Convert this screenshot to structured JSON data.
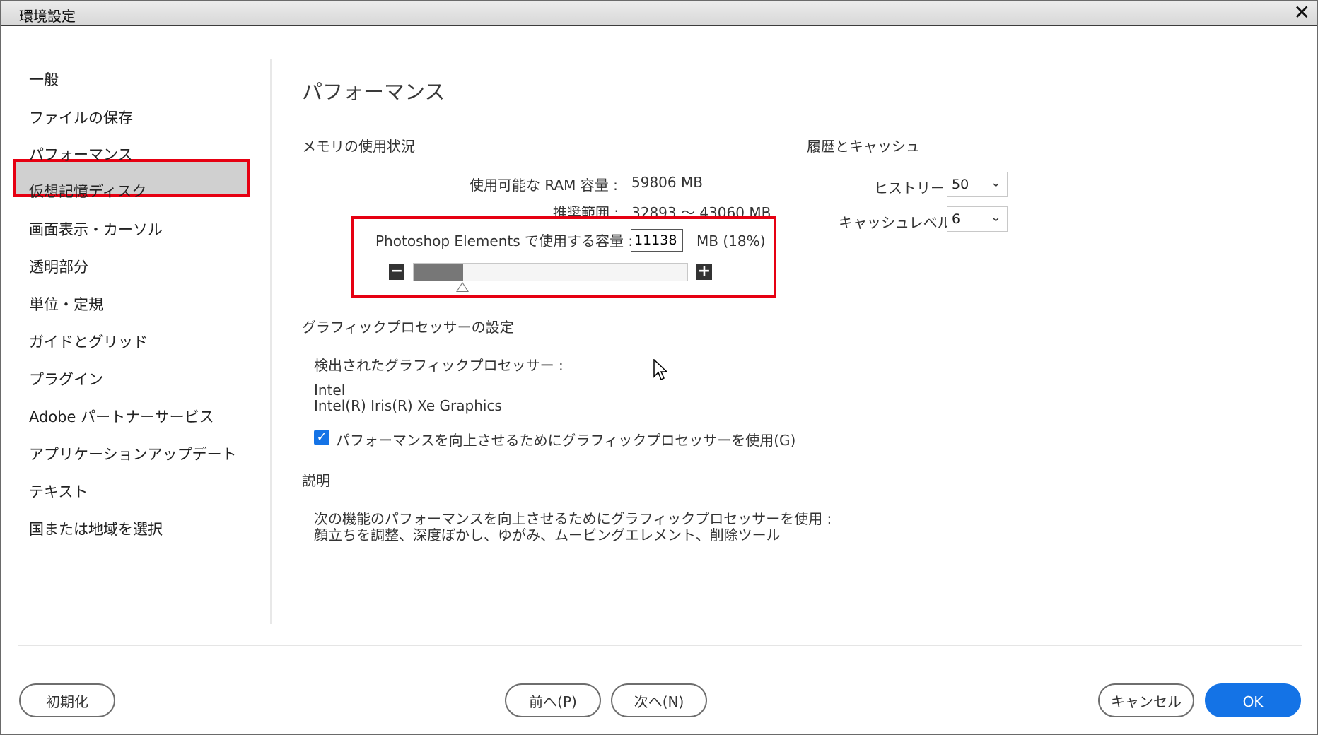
{
  "window": {
    "title": "環境設定",
    "close_symbol": "✕"
  },
  "sidebar": {
    "items": [
      {
        "label": "一般"
      },
      {
        "label": "ファイルの保存"
      },
      {
        "label": "パフォーマンス",
        "selected": true
      },
      {
        "label": "仮想記憶ディスク"
      },
      {
        "label": "画面表示・カーソル"
      },
      {
        "label": "透明部分"
      },
      {
        "label": "単位・定規"
      },
      {
        "label": "ガイドとグリッド"
      },
      {
        "label": "プラグイン"
      },
      {
        "label": "Adobe パートナーサービス"
      },
      {
        "label": "アプリケーションアップデート"
      },
      {
        "label": "テキスト"
      },
      {
        "label": "国または地域を選択"
      }
    ]
  },
  "main": {
    "title": "パフォーマンス",
    "memory": {
      "section_title": "メモリの使用状況",
      "available_label": "使用可能な RAM 容量 :",
      "available_value": "59806 MB",
      "range_label": "推奨範囲 :",
      "range_value": "32893 ～ 43060 MB",
      "usage_label": "Photoshop Elements で使用する容量 :",
      "usage_value": "11138",
      "usage_unit": "MB (18%)",
      "usage_fraction": 0.18,
      "minus_symbol": "−",
      "plus_symbol": "+"
    },
    "history": {
      "section_title": "履歴とキャッシュ",
      "history_label": "ヒストリー :",
      "history_value": "50",
      "cache_label": "キャッシュレベル :",
      "cache_value": "6",
      "chevron": "⌄"
    },
    "gpu": {
      "section_title": "グラフィックプロセッサーの設定",
      "detected_label": "検出されたグラフィックプロセッサー :",
      "vendor": "Intel",
      "model": "Intel(R) Iris(R) Xe Graphics",
      "checkbox_label": "パフォーマンスを向上させるためにグラフィックプロセッサーを使用(G)",
      "checkbox_checked": true,
      "check_symbol": "✓"
    },
    "description": {
      "section_title": "説明",
      "line1": "次の機能のパフォーマンスを向上させるためにグラフィックプロセッサーを使用 :",
      "line2": "顔立ちを調整、深度ぼかし、ゆがみ、ムービングエレメント、削除ツール"
    }
  },
  "footer": {
    "reset_label": "初期化",
    "prev_label": "前へ(P)",
    "next_label": "次へ(N)",
    "cancel_label": "キャンセル",
    "ok_label": "OK"
  },
  "colors": {
    "accent": "#1473e6",
    "highlight": "#e60012",
    "selected_bg": "#d0d0d0"
  }
}
